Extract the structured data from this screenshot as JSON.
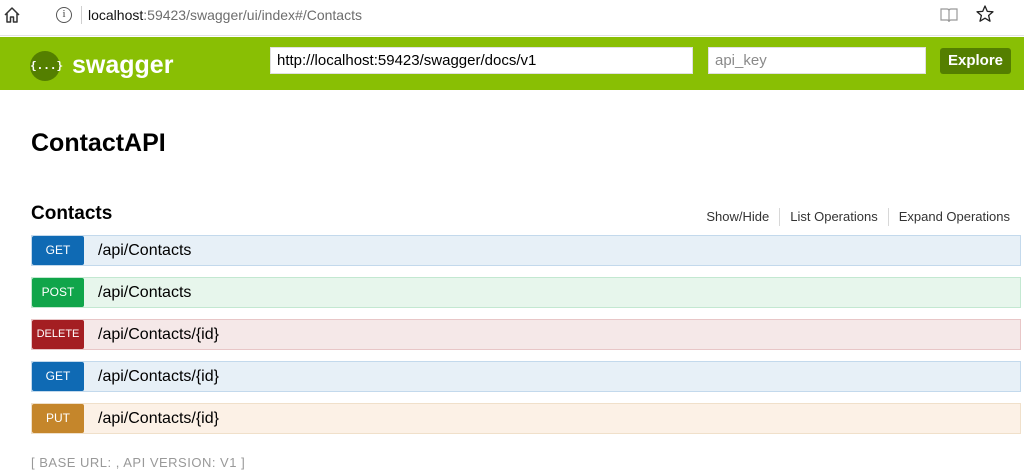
{
  "browser": {
    "url_host": "localhost",
    "url_rest": ":59423/swagger/ui/index#/Contacts"
  },
  "header": {
    "logo_text": "{...}",
    "brand": "swagger",
    "spec_url": "http://localhost:59423/swagger/docs/v1",
    "api_key_placeholder": "api_key",
    "explore_label": "Explore",
    "brand_color": "#89bf04"
  },
  "api": {
    "title": "ContactAPI"
  },
  "resource": {
    "name": "Contacts",
    "links": [
      "Show/Hide",
      "List Operations",
      "Expand Operations"
    ]
  },
  "operations": [
    {
      "method": "GET",
      "path": "/api/Contacts"
    },
    {
      "method": "POST",
      "path": "/api/Contacts"
    },
    {
      "method": "DELETE",
      "path": "/api/Contacts/{id}"
    },
    {
      "method": "GET",
      "path": "/api/Contacts/{id}"
    },
    {
      "method": "PUT",
      "path": "/api/Contacts/{id}"
    }
  ],
  "footer": {
    "text": "[ BASE URL: , API VERSION: V1 ]"
  },
  "method_colors": {
    "GET": "#0f6ab4",
    "POST": "#10a54a",
    "DELETE": "#a41e22",
    "PUT": "#c5862b"
  }
}
